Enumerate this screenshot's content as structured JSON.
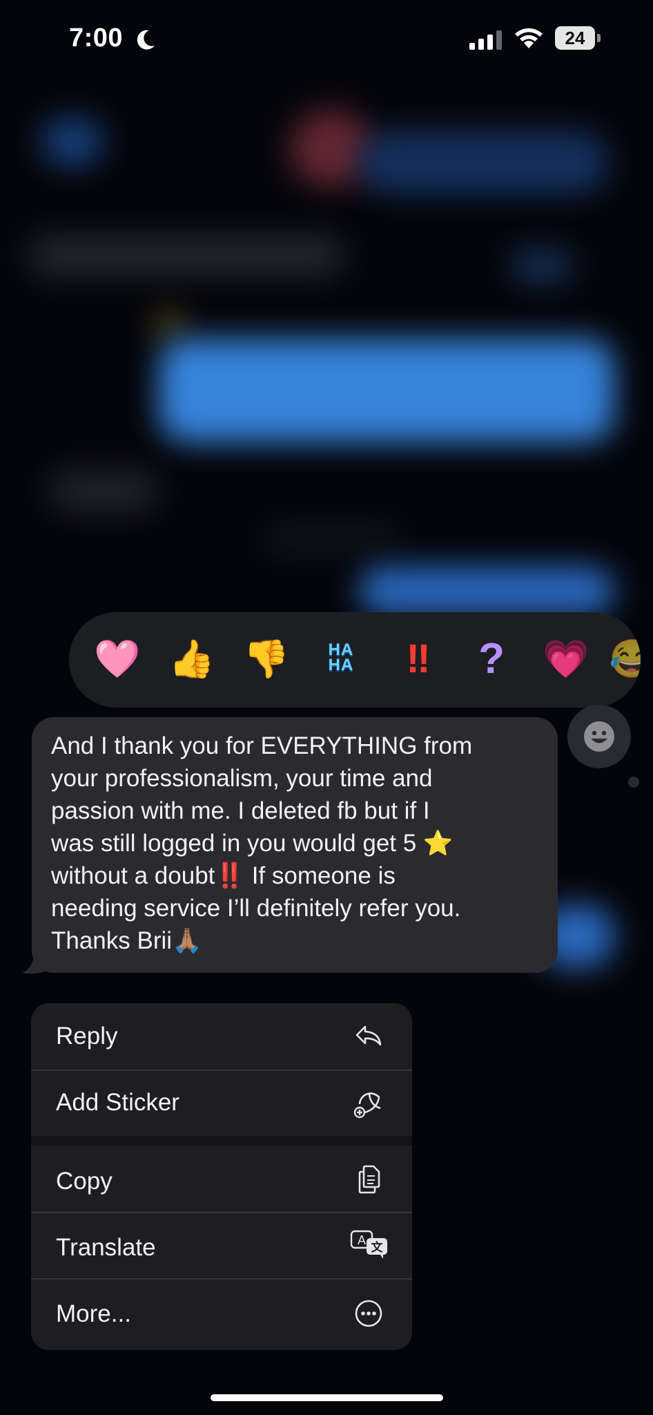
{
  "status_bar": {
    "time": "7:00",
    "battery": "24",
    "icons": [
      "moon-icon",
      "signal-icon",
      "wifi-icon",
      "battery-icon"
    ]
  },
  "reactions": [
    {
      "name": "heart-pink",
      "glyph": "🩷"
    },
    {
      "name": "thumbs-up",
      "glyph": "👍"
    },
    {
      "name": "thumbs-down",
      "glyph": "👎"
    },
    {
      "name": "haha",
      "glyph": "HA\nHA"
    },
    {
      "name": "exclamation",
      "glyph": "‼"
    },
    {
      "name": "question",
      "glyph": "?"
    },
    {
      "name": "heart-magenta",
      "glyph": "💗"
    },
    {
      "name": "more-emoji",
      "glyph": "😂"
    }
  ],
  "message": {
    "text": "And I thank you for EVERYTHING from\nyour professionalism, your time and\npassion with me. I deleted fb but if I\nwas still logged in you would get 5 ⭐\nwithout a doubt‼️ If someone is\nneeding service I’ll definitely refer you.\nThanks Brii🙏🏽"
  },
  "menu": {
    "items": [
      {
        "label": "Reply",
        "icon": "reply-icon"
      },
      {
        "label": "Add Sticker",
        "icon": "add-sticker-icon"
      },
      {
        "label": "Copy",
        "icon": "copy-icon"
      },
      {
        "label": "Translate",
        "icon": "translate-icon"
      },
      {
        "label": "More...",
        "icon": "more-icon"
      }
    ]
  },
  "colors": {
    "background": "#04050a",
    "bubble": "#2b2b2f",
    "menu": "#1e1e21",
    "accent_blue": "#3a8ae6"
  }
}
